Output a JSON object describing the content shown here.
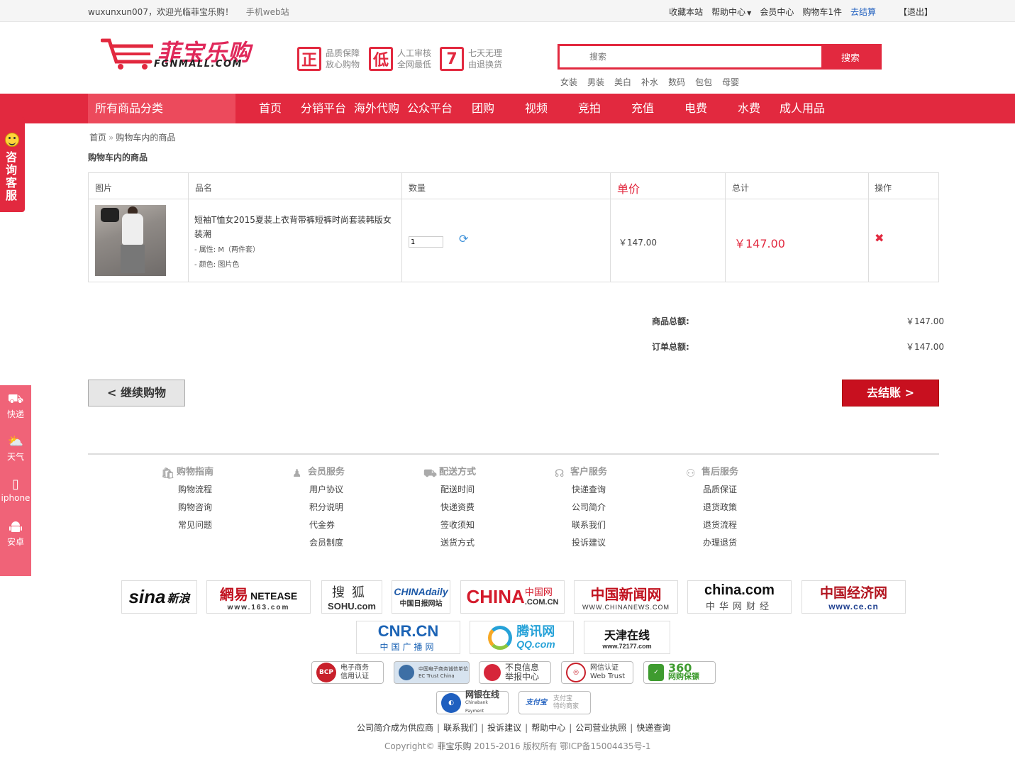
{
  "topbar": {
    "welcome": "wuxunxun007，欢迎光临菲宝乐购！",
    "mobile": "手机web站",
    "favorite": "收藏本站",
    "help": "帮助中心",
    "member": "会员中心",
    "cart": "购物车1件",
    "checkout": "去结算",
    "logout": "【退出】"
  },
  "logo": {
    "cn": "菲宝乐购",
    "en": "FGNMALL.COM"
  },
  "promises": [
    {
      "badge": "正",
      "line1": "品质保障",
      "line2": "放心购物"
    },
    {
      "badge": "低",
      "line1": "人工审核",
      "line2": "全网最低"
    },
    {
      "badge": "7",
      "line1": "七天无理",
      "line2": "由退换货"
    }
  ],
  "search": {
    "placeholder": "搜索",
    "button": "搜索"
  },
  "hot_keywords": [
    "女装",
    "男装",
    "美白",
    "补水",
    "数码",
    "包包",
    "母婴"
  ],
  "nav": {
    "category": "所有商品分类",
    "items": [
      "首页",
      "分销平台",
      "海外代购",
      "公众平台",
      "团购",
      "视频",
      "竞拍",
      "充值",
      "电费",
      "水费",
      "成人用品"
    ]
  },
  "float_service": {
    "label": "咨询客服"
  },
  "float_tools": [
    {
      "icon": "truck-icon",
      "label": "快递"
    },
    {
      "icon": "weather-icon",
      "label": "天气"
    },
    {
      "icon": "phone-icon",
      "label": "iphone"
    },
    {
      "icon": "android-icon",
      "label": "安卓"
    }
  ],
  "breadcrumb": {
    "home": "首页",
    "sep": "»",
    "current": "购物车内的商品"
  },
  "section_title": "购物车内的商品",
  "table": {
    "headers": {
      "image": "图片",
      "name": "品名",
      "qty": "数量",
      "unit": "单价",
      "total": "总计",
      "op": "操作"
    },
    "row": {
      "name": "短袖T恤女2015夏装上衣背带裤短裤时尚套装韩版女装潮",
      "attr1": "- 属性: M（两件套）",
      "attr2": "- 颜色: 图片色",
      "qty": "1",
      "unit_price": "￥147.00",
      "total": "￥147.00"
    }
  },
  "summary": {
    "goods_label": "商品总额:",
    "goods_value": "￥147.00",
    "order_label": "订单总额:",
    "order_value": "￥147.00"
  },
  "buttons": {
    "continue": "< 继续购物",
    "checkout": "去结账 >"
  },
  "help": [
    {
      "title": "购物指南",
      "icon": "bag-icon",
      "links": [
        "购物流程",
        "购物咨询",
        "常见问题"
      ]
    },
    {
      "title": "会员服务",
      "icon": "user-icon",
      "links": [
        "用户协议",
        "积分说明",
        "代金券",
        "会员制度"
      ]
    },
    {
      "title": "配送方式",
      "icon": "truck-icon",
      "links": [
        "配送时间",
        "快递资费",
        "签收须知",
        "送货方式"
      ]
    },
    {
      "title": "客户服务",
      "icon": "headset-icon",
      "links": [
        "快递查询",
        "公司简介",
        "联系我们",
        "投诉建议"
      ]
    },
    {
      "title": "售后服务",
      "icon": "users-icon",
      "links": [
        "品质保证",
        "退货政策",
        "退货流程",
        "办理退货"
      ]
    }
  ],
  "media_logos": {
    "sina": {
      "a": "sina",
      "b": "新浪"
    },
    "netease": {
      "a": "網易",
      "b": "NETEASE",
      "c": "www.163.com"
    },
    "sohu": {
      "a": "搜狐",
      "b": "SOHU.com"
    },
    "chinadaily": {
      "a": "CHINAdaily",
      "b": "中国日报网站"
    },
    "chinacomcn": {
      "a": "CHINA",
      "b": "中国网",
      "c": ".COM.CN"
    },
    "chinanews": {
      "a": "中国新闻网",
      "b": "WWW.CHINANEWS.COM"
    },
    "chinacom": {
      "a": "china.com",
      "b": "中华网财经"
    },
    "ce": {
      "a": "中国经济网",
      "b": "www.ce.cn"
    },
    "cnr": {
      "a": "CNR.CN",
      "b": "中国广播网"
    },
    "qq": {
      "a": "腾讯网",
      "b": "QQ.com"
    },
    "tianjin": {
      "a": "天津在线",
      "b": "www.72177.com"
    }
  },
  "trust_badges": {
    "bcp": {
      "a": "电子商务",
      "b": "信用认证"
    },
    "ectrust": {
      "a": "中国电子商务诚信单位",
      "b": "EC Trust China"
    },
    "report": {
      "a": "不良信息",
      "b": "举报中心"
    },
    "webtrust": {
      "a": "网信认证",
      "b": "Web Trust"
    },
    "s360": {
      "a": "360",
      "b": "网购保镖"
    },
    "chinabank": {
      "a": "网银在线",
      "b": "Chinabank Payment"
    },
    "alipay": {
      "a": "支付宝",
      "b": "特约商家"
    }
  },
  "footer": {
    "links": [
      "公司简介",
      "成为供应商",
      "联系我们",
      "投诉建议",
      "帮助中心",
      "公司营业执照",
      "快递查询"
    ],
    "copyright_prefix": "Copyright© ",
    "brand": "菲宝乐购",
    "copyright_suffix": " 2015-2016 版权所有 鄂ICP备15004435号-1"
  },
  "colors": {
    "brand_red": "#e2293f",
    "checkout_red": "#c8101f",
    "float_pink": "#f06378",
    "link_blue": "#1f5fbf"
  }
}
